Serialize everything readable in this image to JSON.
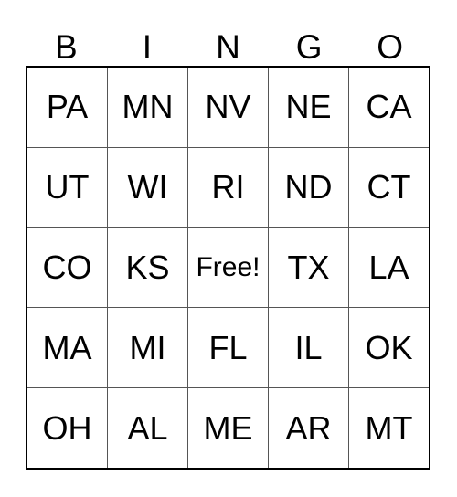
{
  "card": {
    "header_letters": [
      "B",
      "I",
      "N",
      "G",
      "O"
    ],
    "free_space_label": "Free!",
    "colors": {
      "background": "#ffffff",
      "text": "#000000",
      "outer_border": "#000000",
      "inner_grid_line": "#555555"
    },
    "rows": [
      {
        "cells": [
          "PA",
          "MN",
          "NV",
          "NE",
          "CA"
        ]
      },
      {
        "cells": [
          "UT",
          "WI",
          "RI",
          "ND",
          "CT"
        ]
      },
      {
        "cells": [
          "CO",
          "KS",
          "Free!",
          "TX",
          "LA"
        ]
      },
      {
        "cells": [
          "MA",
          "MI",
          "FL",
          "IL",
          "OK"
        ]
      },
      {
        "cells": [
          "OH",
          "AL",
          "ME",
          "AR",
          "MT"
        ]
      }
    ]
  }
}
